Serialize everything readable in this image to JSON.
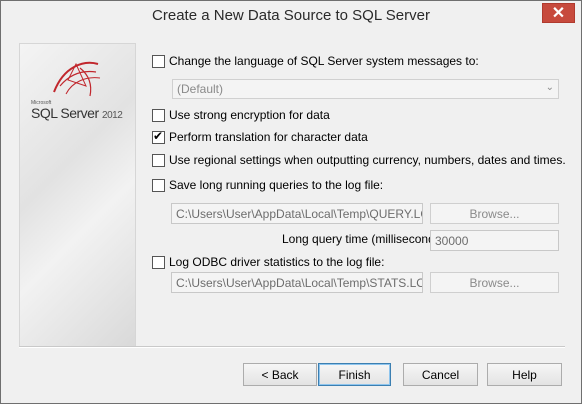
{
  "window": {
    "title": "Create a New Data Source to SQL Server",
    "close_glyph": "✕"
  },
  "logo": {
    "brand_small": "Microsoft",
    "product": "SQL Server",
    "version": "2012"
  },
  "options": {
    "change_language": {
      "label": "Change the language of SQL Server system messages to:",
      "checked": false
    },
    "language_select": {
      "value": "(Default)"
    },
    "strong_encryption": {
      "label": "Use strong encryption for data",
      "checked": false
    },
    "translation": {
      "label": "Perform translation for character data",
      "checked": true
    },
    "regional_settings": {
      "label": "Use regional settings when outputting currency, numbers, dates and times.",
      "checked": false
    },
    "save_long_queries": {
      "label": "Save long running queries to the log file:",
      "checked": false
    },
    "query_log_path": "C:\\Users\\User\\AppData\\Local\\Temp\\QUERY.LOG",
    "browse_1": "Browse...",
    "long_query_time_label": "Long query time (milliseconds):",
    "long_query_time_value": "30000",
    "log_odbc_stats": {
      "label": "Log ODBC driver statistics to the log file:",
      "checked": false
    },
    "stats_log_path": "C:\\Users\\User\\AppData\\Local\\Temp\\STATS.LOG",
    "browse_2": "Browse..."
  },
  "buttons": {
    "back": "< Back",
    "finish": "Finish",
    "cancel": "Cancel",
    "help": "Help"
  },
  "icons": {
    "close": "close-icon",
    "dropdown": "chevron-down-icon",
    "check": "checkmark-icon"
  },
  "colors": {
    "close_button": "#c74a3d",
    "default_button_border": "#3c7fb1"
  }
}
